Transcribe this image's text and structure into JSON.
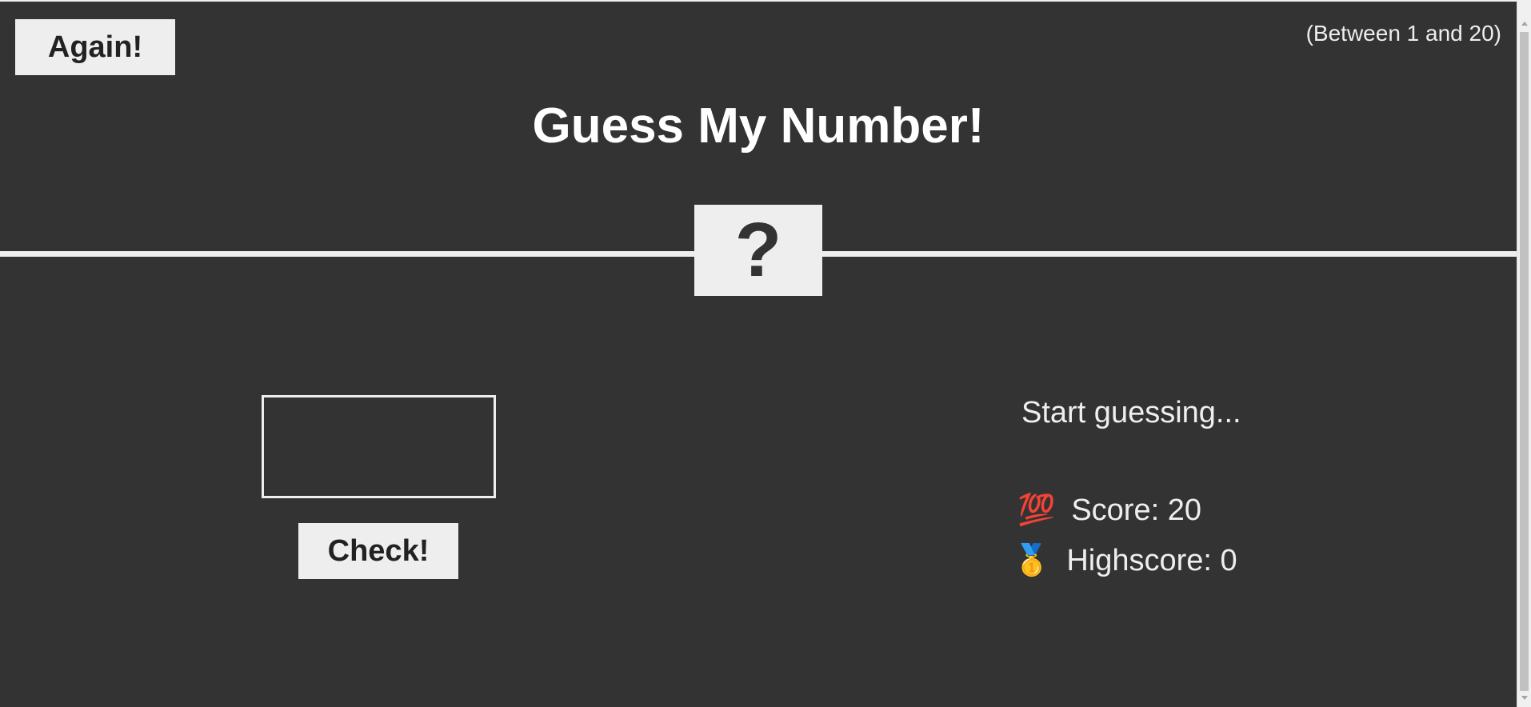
{
  "header": {
    "again_label": "Again!",
    "range_text": "(Between 1 and 20)",
    "title": "Guess My Number!",
    "secret_number_display": "?"
  },
  "left": {
    "guess_value": "",
    "check_label": "Check!"
  },
  "right": {
    "message": "Start guessing...",
    "score_icon": "💯",
    "score_text": "Score: 20",
    "highscore_icon": "🥇",
    "highscore_text": "Highscore: 0"
  },
  "colors": {
    "background": "#333333",
    "foreground": "#eeeeee"
  }
}
